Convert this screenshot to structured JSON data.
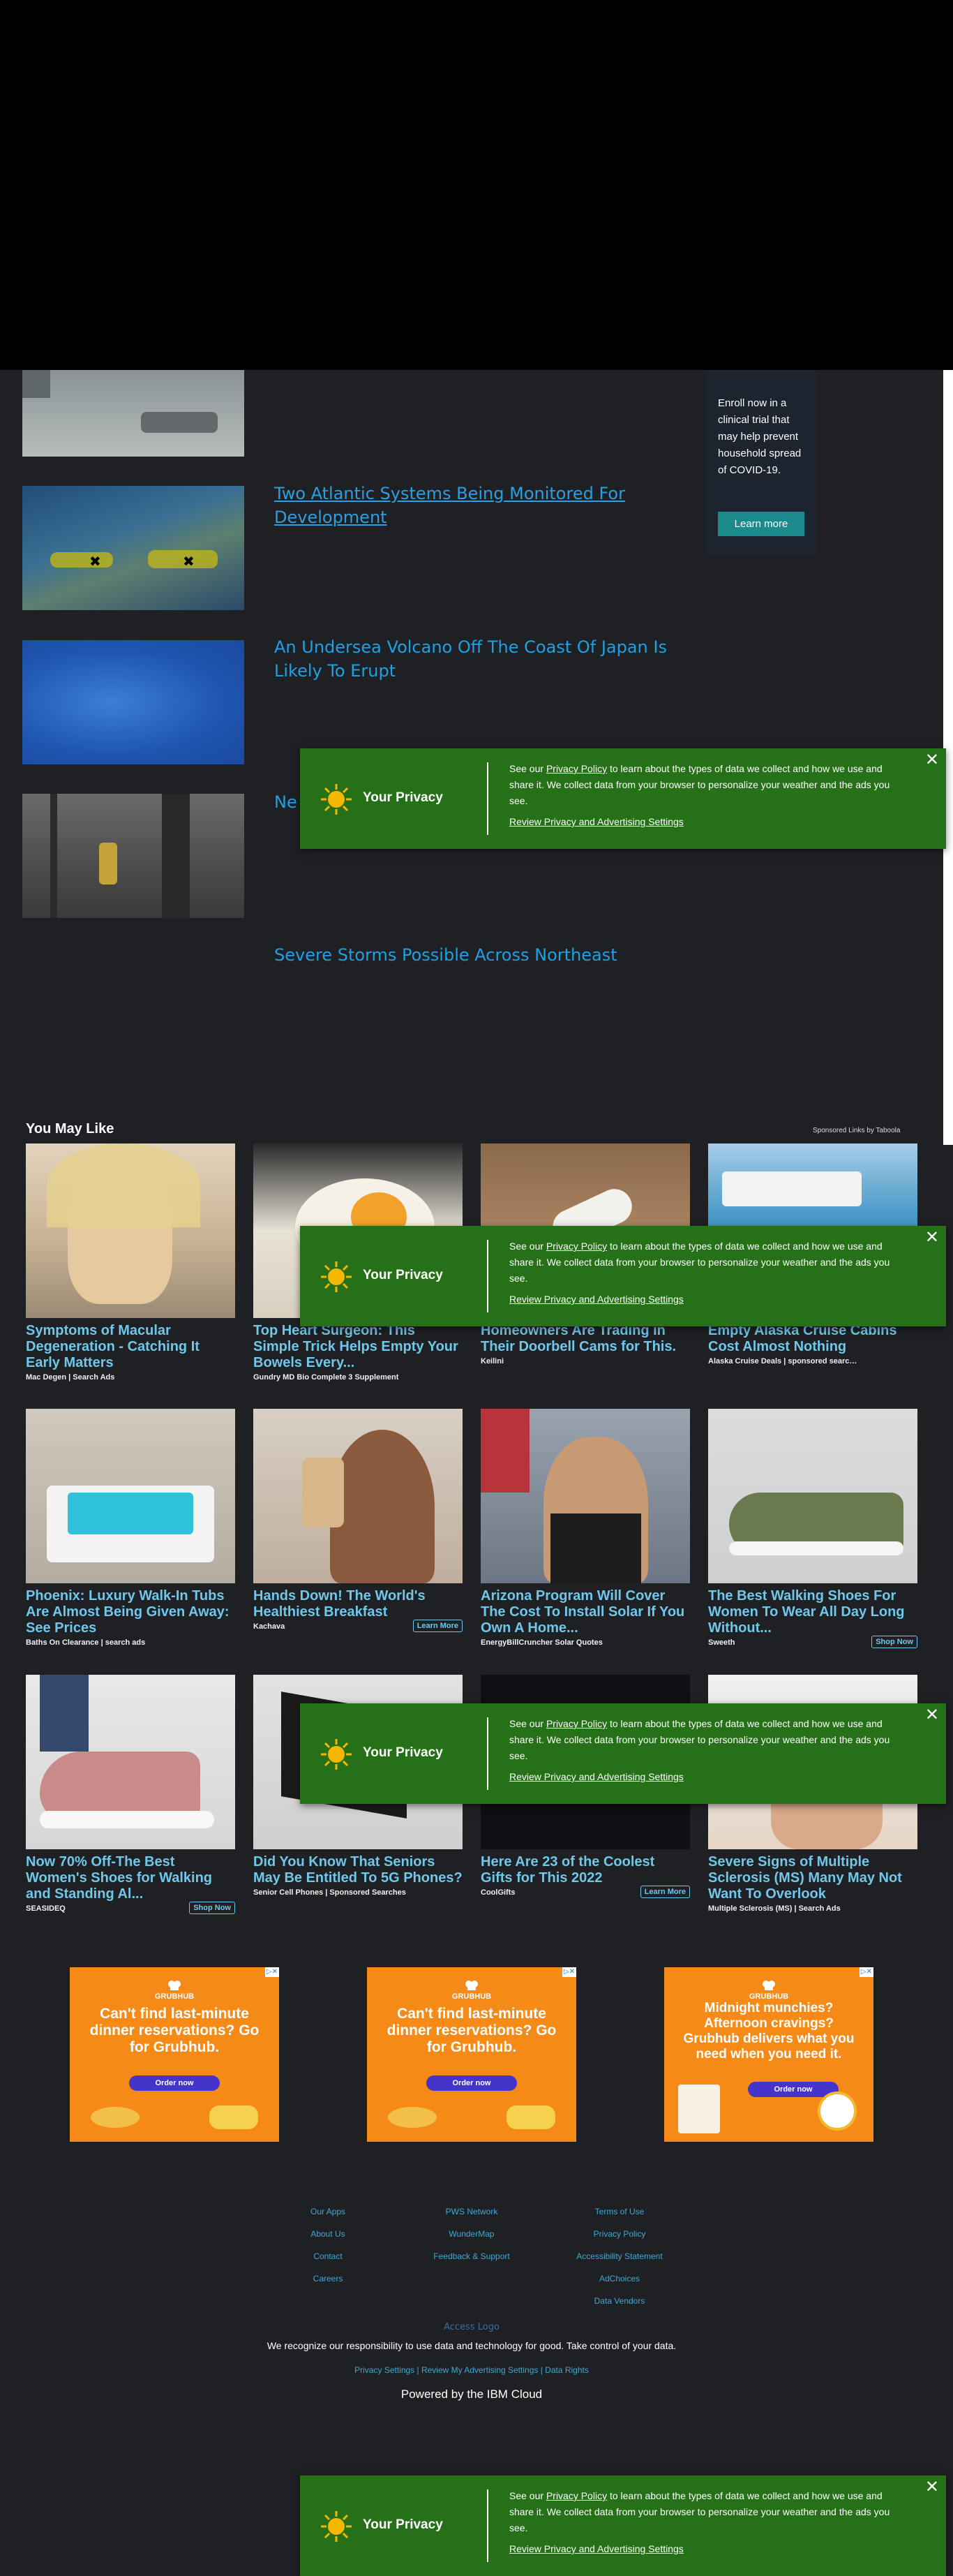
{
  "articles": [
    {
      "title": ""
    },
    {
      "title": "Two Atlantic Systems Being Monitored For Development"
    },
    {
      "title": "An Undersea Volcano Off The Coast Of Japan Is Likely To Erupt"
    },
    {
      "title": "Ne"
    },
    {
      "title": "Severe Storms Possible Across Northeast"
    }
  ],
  "sidebar_ad": {
    "text": "Enroll now in a clinical trial that may help prevent household spread of COVID-19.",
    "cta": "Learn more"
  },
  "privacy": {
    "title": "Your Privacy",
    "text_before": "See our ",
    "link_text": "Privacy Policy",
    "text_after": " to learn about the types of data we collect and how we use and share it. We collect data from your browser to personalize your weather and the ads you see.",
    "review_link": "Review Privacy and Advertising Settings",
    "close": "✕"
  },
  "you_may_like": {
    "title": "You May Like",
    "sponsored": "Sponsored Links by Taboola",
    "cards": [
      {
        "title": "Symptoms of Macular Degeneration - Catching It Early Matters",
        "source": "Mac Degen | Search Ads",
        "button": ""
      },
      {
        "title": "Top Heart Surgeon: This Simple Trick Helps Empty Your Bowels Every...",
        "source": "Gundry MD Bio Complete 3 Supplement",
        "button": ""
      },
      {
        "title": "Homeowners Are Trading in Their Doorbell Cams for This.",
        "source": "Keilini",
        "button": ""
      },
      {
        "title": "Empty Alaska Cruise Cabins Cost Almost Nothing",
        "source": "Alaska Cruise Deals | sponsored searches",
        "button": ""
      },
      {
        "title": "Phoenix: Luxury Walk-In Tubs Are Almost Being Given Away: See Prices",
        "source": "Baths On Clearance | search ads",
        "button": ""
      },
      {
        "title": "Hands Down! The World's Healthiest Breakfast",
        "source": "Kachava",
        "button": "Learn More"
      },
      {
        "title": "Arizona Program Will Cover The Cost To Install Solar If You Own A Home...",
        "source": "EnergyBillCruncher Solar Quotes",
        "button": ""
      },
      {
        "title": "The Best Walking Shoes For Women To Wear All Day Long Without...",
        "source": "Sweeth",
        "button": "Shop Now"
      },
      {
        "title": "Now 70% Off-The Best Women's Shoes for Walking and Standing Al...",
        "source": "SEASIDEQ",
        "button": "Shop Now"
      },
      {
        "title": "Did You Know That Seniors May Be Entitled To 5G Phones?",
        "source": "Senior Cell Phones | Sponsored Searches",
        "button": ""
      },
      {
        "title": "Here Are 23 of the Coolest Gifts for This 2022",
        "source": "CoolGifts",
        "button": "Learn More"
      },
      {
        "title": "Severe Signs of Multiple Sclerosis (MS) Many May Not Want To Overlook",
        "source": "Multiple Sclerosis (MS) | Search Ads",
        "button": ""
      }
    ]
  },
  "grubhub_ads": [
    {
      "brand": "GRUBHUB",
      "headline": "Can't find last-minute dinner reservations? Go for Grubhub.",
      "cta": "Order now"
    },
    {
      "brand": "GRUBHUB",
      "headline": "Can't find last-minute dinner reservations? Go for Grubhub.",
      "cta": "Order now"
    },
    {
      "brand": "GRUBHUB",
      "headline": "Midnight munchies? Afternoon cravings? Grubhub delivers what you need when you need it.",
      "cta": "Order now"
    }
  ],
  "footer": {
    "col1": [
      "Our Apps",
      "About Us",
      "Contact",
      "Careers"
    ],
    "col2": [
      "PWS Network",
      "WunderMap",
      "Feedback & Support"
    ],
    "col3": [
      "Terms of Use",
      "Privacy Policy",
      "Accessibility Statement",
      "AdChoices",
      "Data Vendors"
    ],
    "access_logo": "Access Logo",
    "responsibility": "We recognize our responsibility to use data and technology for good. Take control of your data.",
    "privacy_links": "Privacy Settings | Review My Advertising Settings | Data Rights",
    "powered_by": "Powered by the IBM Cloud"
  },
  "colors": {
    "privacy_bg": "#267018",
    "link": "#1da1e6",
    "card_title": "#6fc7ea",
    "grubhub": "#f68a17"
  }
}
